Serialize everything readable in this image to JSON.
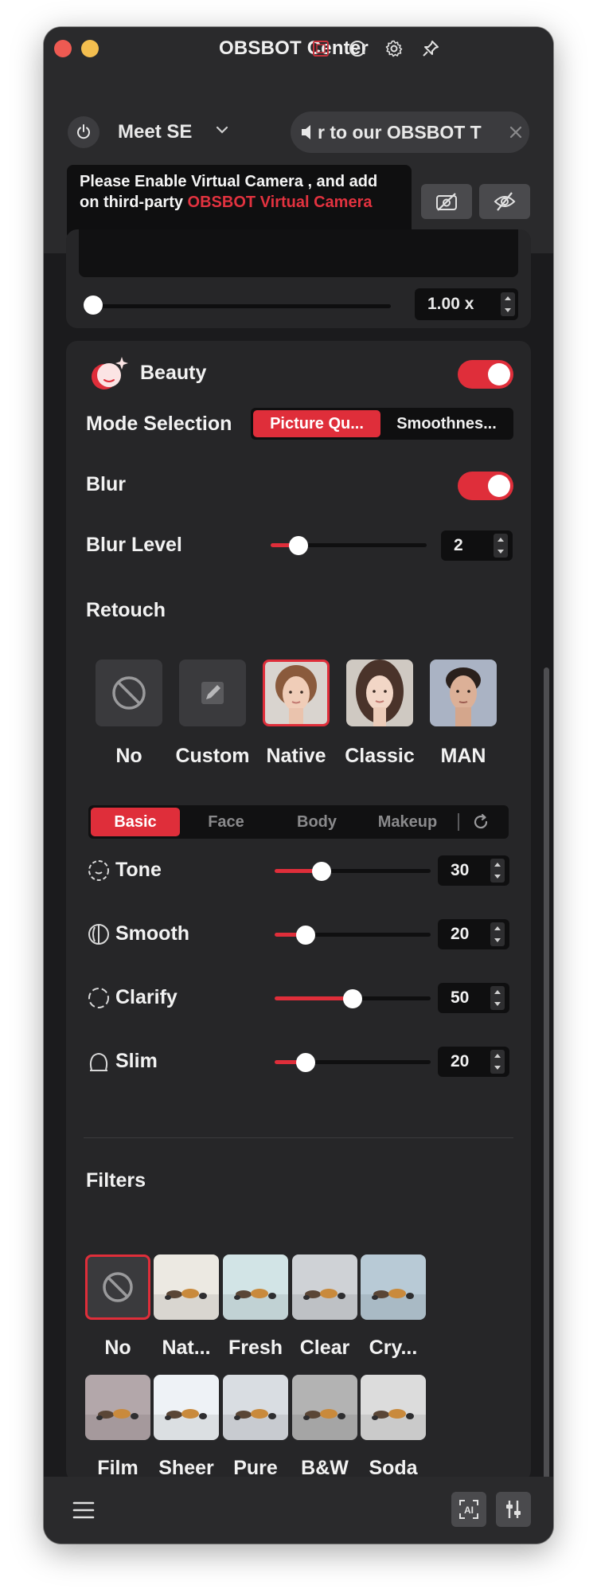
{
  "window": {
    "title": "OBSBOT Center"
  },
  "header": {
    "device_name": "Meet SE",
    "marquee_text": "r to our OBSBOT T",
    "notice": {
      "text_before": "Please Enable Virtual Camera , and add on third-party ",
      "highlight": "OBSBOT Virtual Camera"
    }
  },
  "zoom": {
    "value_label": "1.00 x",
    "level": 0.0
  },
  "beauty": {
    "title": "Beauty",
    "enabled": true,
    "mode_label": "Mode Selection",
    "modes": [
      "Picture Qu...",
      "Smoothnes..."
    ],
    "mode_selected": 0,
    "blur_label": "Blur",
    "blur_enabled": true,
    "blur_level_label": "Blur Level",
    "blur_level": {
      "value": "2",
      "fraction": 0.18
    },
    "retouch_label": "Retouch",
    "retouch_presets": [
      "No",
      "Custom",
      "Native",
      "Classic",
      "MAN"
    ],
    "retouch_selected": 2,
    "tabs": [
      "Basic",
      "Face",
      "Body",
      "Makeup"
    ],
    "tab_selected": 0,
    "adjustments": [
      {
        "label": "Tone",
        "value": "30",
        "fraction": 0.3
      },
      {
        "label": "Smooth",
        "value": "20",
        "fraction": 0.2
      },
      {
        "label": "Clarify",
        "value": "50",
        "fraction": 0.5
      },
      {
        "label": "Slim",
        "value": "20",
        "fraction": 0.2
      }
    ]
  },
  "filters": {
    "title": "Filters",
    "items": [
      "No",
      "Nat...",
      "Fresh",
      "Clear",
      "Cry...",
      "Film",
      "Sheer",
      "Pure",
      "B&W",
      "Soda"
    ],
    "selected": 0
  },
  "colors": {
    "accent": "#df2e3a",
    "panel": "#262628",
    "background": "#1b1b1d"
  }
}
